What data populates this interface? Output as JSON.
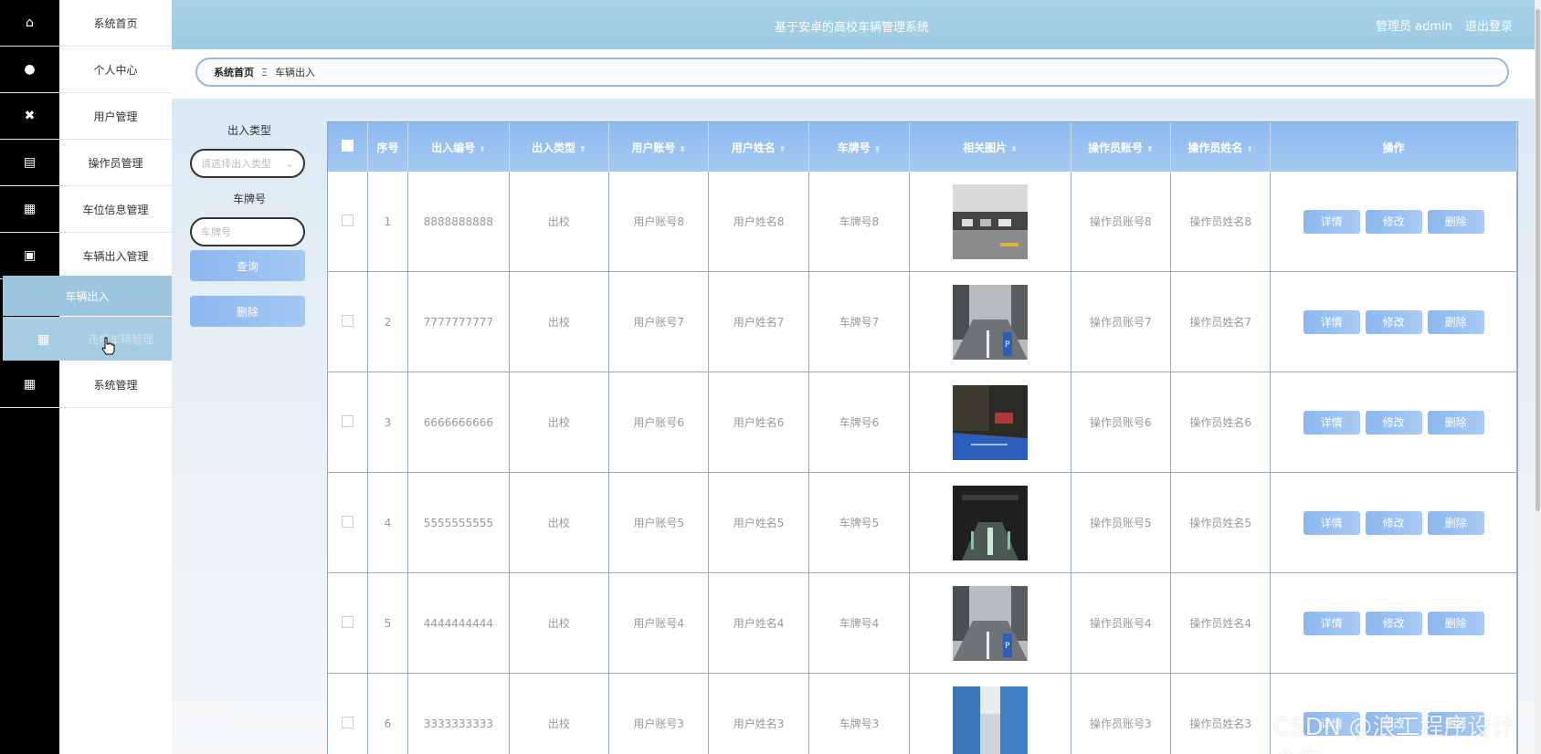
{
  "header": {
    "title": "基于安卓的高校车辆管理系统",
    "user": "管理员 admin",
    "logout": "退出登录"
  },
  "sidebar": {
    "items": [
      {
        "label": "系统首页",
        "icon": "home-icon",
        "glyph": "⌂"
      },
      {
        "label": "个人中心",
        "icon": "user-icon",
        "glyph": "●"
      },
      {
        "label": "用户管理",
        "icon": "users-icon",
        "glyph": "✖"
      },
      {
        "label": "操作员管理",
        "icon": "chart-icon",
        "glyph": "▤"
      },
      {
        "label": "车位信息管理",
        "icon": "grid-icon",
        "glyph": "▦"
      },
      {
        "label": "车辆出入管理",
        "icon": "clipboard-icon",
        "glyph": "▣"
      }
    ],
    "open_submenu": "车辆出入",
    "hover_item": "违规车辆管理",
    "last_item": {
      "label": "系统管理",
      "icon": "grid-icon",
      "glyph": "▦"
    }
  },
  "breadcrumb": {
    "home": "系统首页",
    "separator": "Ξ",
    "current": "车辆出入"
  },
  "filters": {
    "type_label": "出入类型",
    "type_placeholder": "请选择出入类型",
    "plate_label": "车牌号",
    "plate_placeholder": "车牌号",
    "search_button": "查询",
    "delete_button": "删除"
  },
  "table": {
    "columns": [
      "序号",
      "出入编号",
      "出入类型",
      "用户账号",
      "用户姓名",
      "车牌号",
      "相关图片",
      "操作员账号",
      "操作员姓名",
      "操作"
    ],
    "actions": {
      "detail": "详情",
      "edit": "修改",
      "delete": "删除"
    },
    "rows": [
      {
        "no": "1",
        "code": "8888888888",
        "type": "出校",
        "account": "用户账号8",
        "name": "用户姓名8",
        "plate": "车牌号8",
        "op_account": "操作员账号8",
        "op_name": "操作员姓名8",
        "img": "garage"
      },
      {
        "no": "2",
        "code": "7777777777",
        "type": "出校",
        "account": "用户账号7",
        "name": "用户姓名7",
        "plate": "车牌号7",
        "op_account": "操作员账号7",
        "op_name": "操作员姓名7",
        "img": "road"
      },
      {
        "no": "3",
        "code": "6666666666",
        "type": "出校",
        "account": "用户账号6",
        "name": "用户姓名6",
        "plate": "车牌号6",
        "op_account": "操作员账号6",
        "op_name": "操作员姓名6",
        "img": "night"
      },
      {
        "no": "4",
        "code": "5555555555",
        "type": "出校",
        "account": "用户账号5",
        "name": "用户姓名5",
        "plate": "车牌号5",
        "op_account": "操作员账号5",
        "op_name": "操作员姓名5",
        "img": "dark"
      },
      {
        "no": "5",
        "code": "4444444444",
        "type": "出校",
        "account": "用户账号4",
        "name": "用户姓名4",
        "plate": "车牌号4",
        "op_account": "操作员账号4",
        "op_name": "操作员姓名4",
        "img": "road"
      },
      {
        "no": "6",
        "code": "3333333333",
        "type": "出校",
        "account": "用户账号3",
        "name": "用户姓名3",
        "plate": "车牌号3",
        "op_account": "操作员账号3",
        "op_name": "操作员姓名3",
        "img": "tunnel"
      }
    ]
  },
  "watermark": "CSDN @浪工程序设计合作",
  "colors": {
    "header": "#9ccbe3",
    "accent": "#8bb8f0",
    "rail": "#000000"
  }
}
